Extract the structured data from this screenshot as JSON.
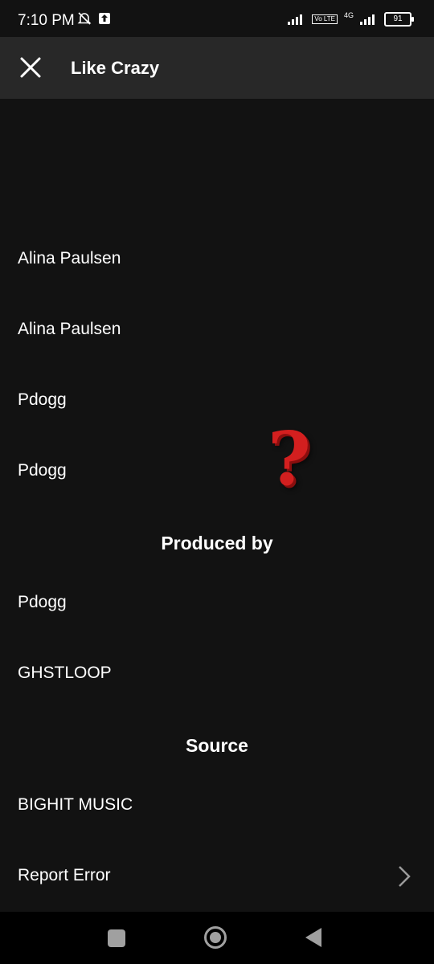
{
  "status_bar": {
    "time": "7:10 PM",
    "network": "4G",
    "volte": "Vo LTE",
    "battery": "91"
  },
  "header": {
    "title": "Like Crazy",
    "close_icon": "close-icon"
  },
  "credits": {
    "rows_top": [
      "Alina Paulsen",
      "Alina Paulsen",
      "Pdogg",
      "Pdogg"
    ],
    "produced_by_heading": "Produced by",
    "produced_by": [
      "Pdogg",
      "GHSTLOOP"
    ],
    "source_heading": "Source",
    "source": [
      "BIGHIT MUSIC"
    ],
    "report_error": "Report Error"
  },
  "overlay": {
    "question_mark": "?",
    "color": "#d31f1f"
  },
  "nav": {
    "recent_icon": "square-icon",
    "home_icon": "circle-icon",
    "back_icon": "triangle-back-icon"
  }
}
